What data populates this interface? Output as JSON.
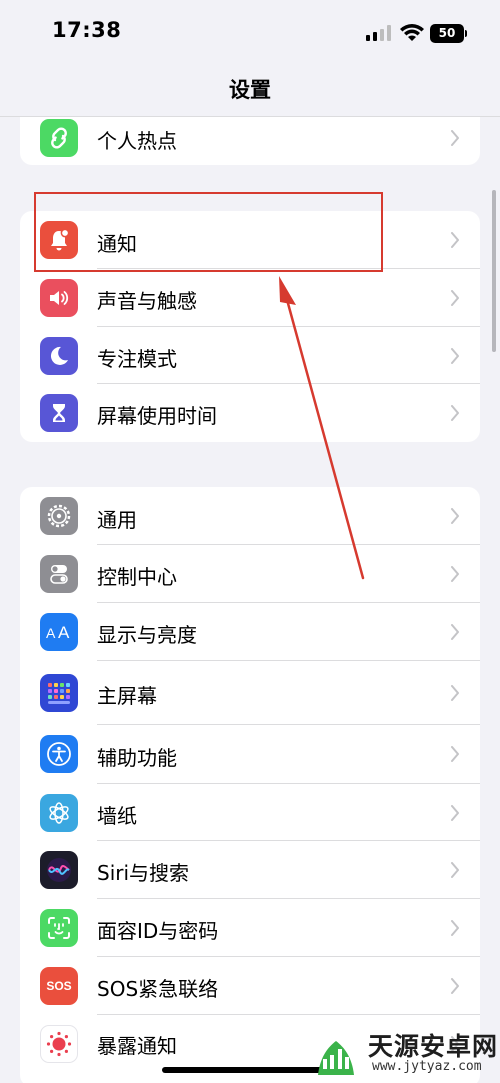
{
  "status_bar": {
    "time": "17:38",
    "battery": "50"
  },
  "nav": {
    "title": "设置"
  },
  "groups": [
    {
      "items": [
        {
          "label": "个人热点",
          "icon": "hotspot-icon",
          "color": "#4cd964"
        }
      ]
    },
    {
      "items": [
        {
          "label": "通知",
          "icon": "bell-icon",
          "color": "#ea4f3d"
        },
        {
          "label": "声音与触感",
          "icon": "speaker-icon",
          "color": "#ea4f5e"
        },
        {
          "label": "专注模式",
          "icon": "moon-icon",
          "color": "#5856d6"
        },
        {
          "label": "屏幕使用时间",
          "icon": "hourglass-icon",
          "color": "#5856d6"
        }
      ]
    },
    {
      "items": [
        {
          "label": "通用",
          "icon": "gear-icon",
          "color": "#8e8e93"
        },
        {
          "label": "控制中心",
          "icon": "toggles-icon",
          "color": "#8e8e93"
        },
        {
          "label": "显示与亮度",
          "icon": "text-size-icon",
          "color": "#1f7cf2"
        },
        {
          "label": "主屏幕",
          "icon": "home-grid-icon",
          "color": "#2f47d4"
        },
        {
          "label": "辅助功能",
          "icon": "accessibility-icon",
          "color": "#1f7cf2"
        },
        {
          "label": "墙纸",
          "icon": "flower-icon",
          "color": "#3aa7e0"
        },
        {
          "label": "Siri与搜索",
          "icon": "siri-icon",
          "color": "#1c1c2a"
        },
        {
          "label": "面容ID与密码",
          "icon": "face-id-icon",
          "color": "#4cd964"
        },
        {
          "label": "SOS紧急联络",
          "icon": "sos-icon",
          "color": "#ea4f3d",
          "icon_text": "SOS"
        },
        {
          "label": "暴露通知",
          "icon": "exposure-icon",
          "color": "#ffffff"
        }
      ]
    }
  ],
  "watermark": {
    "text": "天源安卓网",
    "url": "www.jytyaz.com"
  },
  "annotation": {
    "color": "#d63a2f"
  }
}
